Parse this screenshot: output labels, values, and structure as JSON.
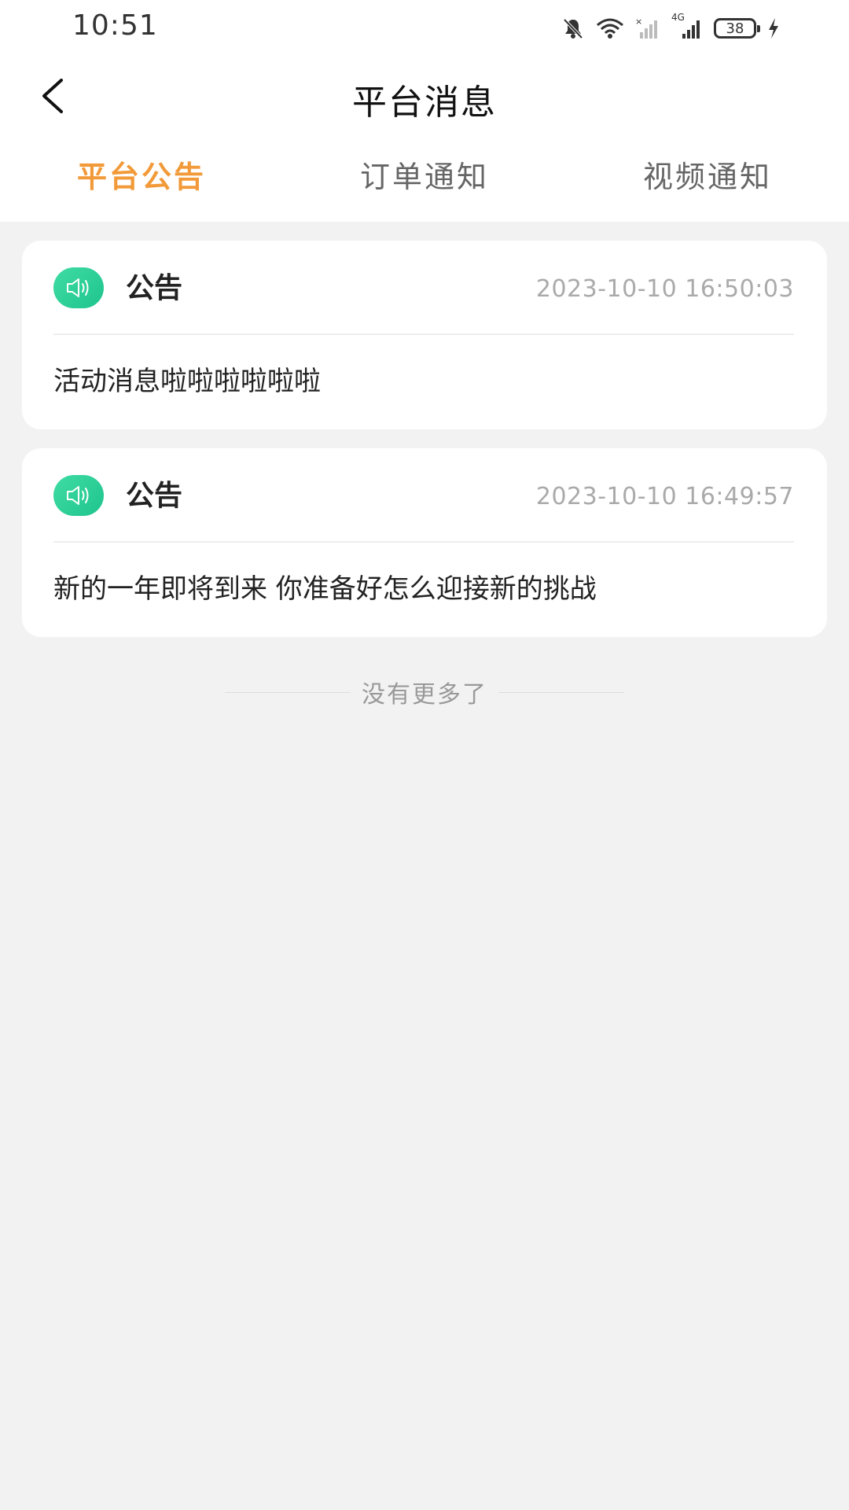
{
  "status_bar": {
    "time": "10:51",
    "icons": [
      "bell-muted-icon",
      "wifi-icon",
      "signal-no-service-icon",
      "signal-4g-icon",
      "battery-icon",
      "charging-icon"
    ],
    "network_label": "4G",
    "battery_level": "38"
  },
  "nav": {
    "title": "平台消息"
  },
  "tabs": [
    {
      "label": "平台公告",
      "active": true
    },
    {
      "label": "订单通知",
      "active": false
    },
    {
      "label": "视频通知",
      "active": false
    }
  ],
  "colors": {
    "accent": "#f29a3a",
    "icon_green": "#1fc48e",
    "background": "#f2f2f2"
  },
  "messages": [
    {
      "icon": "speaker-icon",
      "type": "公告",
      "time": "2023-10-10 16:50:03",
      "content": "活动消息啦啦啦啦啦啦"
    },
    {
      "icon": "speaker-icon",
      "type": "公告",
      "time": "2023-10-10 16:49:57",
      "content": "新的一年即将到来 你准备好怎么迎接新的挑战"
    }
  ],
  "footer": {
    "no_more": "没有更多了"
  }
}
